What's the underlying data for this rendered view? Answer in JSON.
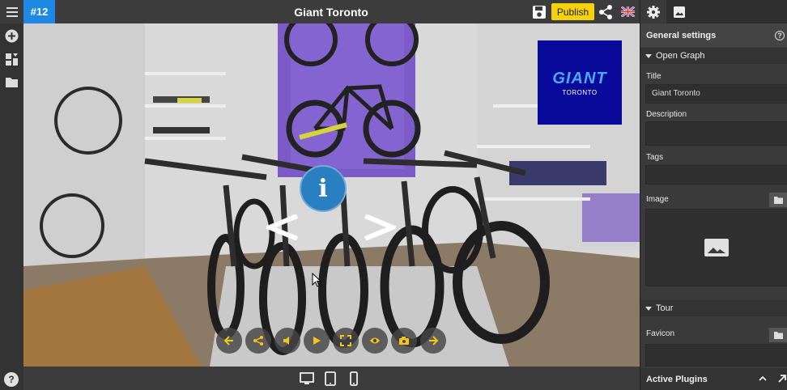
{
  "header": {
    "tour_id": "#12",
    "title": "Giant Toronto",
    "publish_label": "Publish",
    "language": "en-GB"
  },
  "left_toolbar": {
    "tools": [
      "plus-icon",
      "hotspot-layout-icon",
      "folder-icon"
    ],
    "help_label": "?"
  },
  "viewer": {
    "logo": {
      "brand": "GIANT",
      "city": "TORONTO"
    },
    "info_hotspot": "i",
    "controls": [
      "arrow-left-icon",
      "share-icon",
      "volume-icon",
      "play-icon",
      "fullscreen-icon",
      "eye-icon",
      "camera-icon",
      "arrow-right-icon"
    ],
    "accent_color": "#f5c518"
  },
  "bottom_bar": {
    "devices": [
      "desktop-icon",
      "tablet-icon",
      "phone-icon"
    ]
  },
  "panel": {
    "tabs": [
      "gear-icon",
      "image-icon"
    ],
    "title": "General settings",
    "sections": {
      "open_graph": {
        "label": "Open Graph",
        "title_label": "Title",
        "title_value": "Giant Toronto",
        "description_label": "Description",
        "description_value": "",
        "tags_label": "Tags",
        "tags_value": "",
        "image_label": "Image"
      },
      "tour": {
        "label": "Tour",
        "favicon_label": "Favicon",
        "favicon_value": ""
      }
    },
    "active_plugins_label": "Active Plugins"
  }
}
